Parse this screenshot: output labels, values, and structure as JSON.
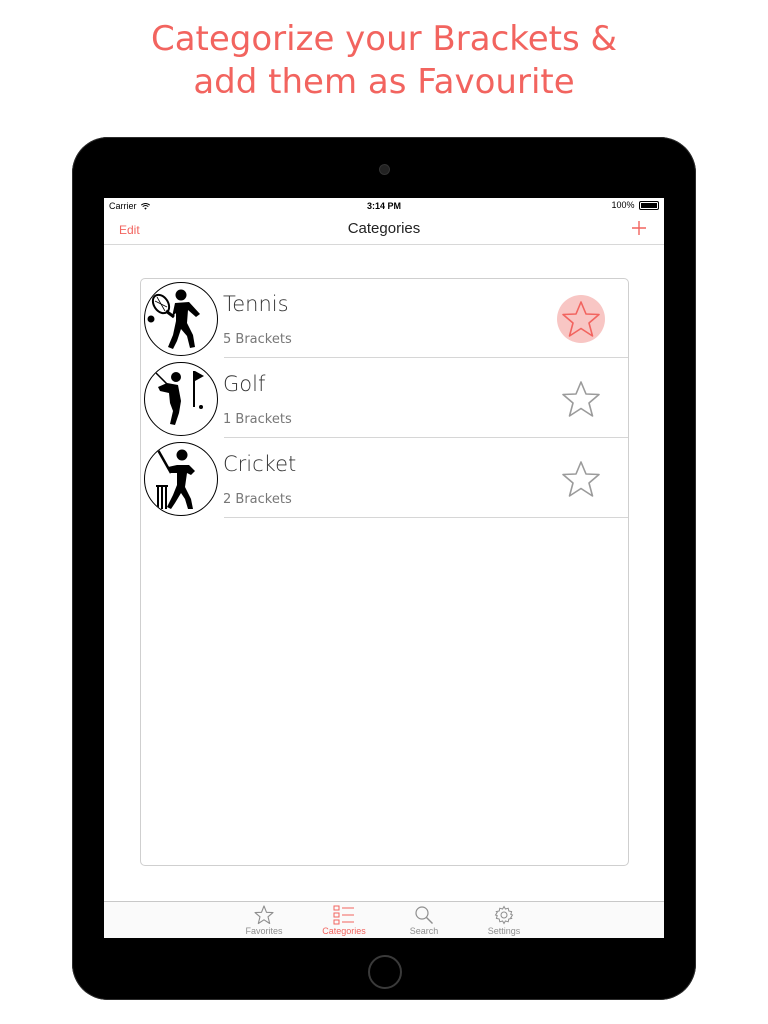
{
  "headline": {
    "line1": "Categorize your Brackets &",
    "line2": "add them as Favourite"
  },
  "status_bar": {
    "carrier": "Carrier",
    "time": "3:14 PM",
    "battery": "100%"
  },
  "nav": {
    "edit_label": "Edit",
    "title": "Categories",
    "add_icon": "plus-icon"
  },
  "categories": [
    {
      "name": "Tennis",
      "count": "5 Brackets",
      "icon": "tennis-icon",
      "favorite": true
    },
    {
      "name": "Golf",
      "count": "1 Brackets",
      "icon": "golf-icon",
      "favorite": false
    },
    {
      "name": "Cricket",
      "count": "2 Brackets",
      "icon": "cricket-icon",
      "favorite": false
    }
  ],
  "tabs": [
    {
      "label": "Favorites",
      "icon": "star-icon",
      "active": false
    },
    {
      "label": "Categories",
      "icon": "list-icon",
      "active": true
    },
    {
      "label": "Search",
      "icon": "magnifier-icon",
      "active": false
    },
    {
      "label": "Settings",
      "icon": "gear-icon",
      "active": false
    }
  ],
  "colors": {
    "accent": "#f2645f",
    "favorite_bg": "#f8c6c4",
    "star_inactive": "#9b9b9b"
  }
}
